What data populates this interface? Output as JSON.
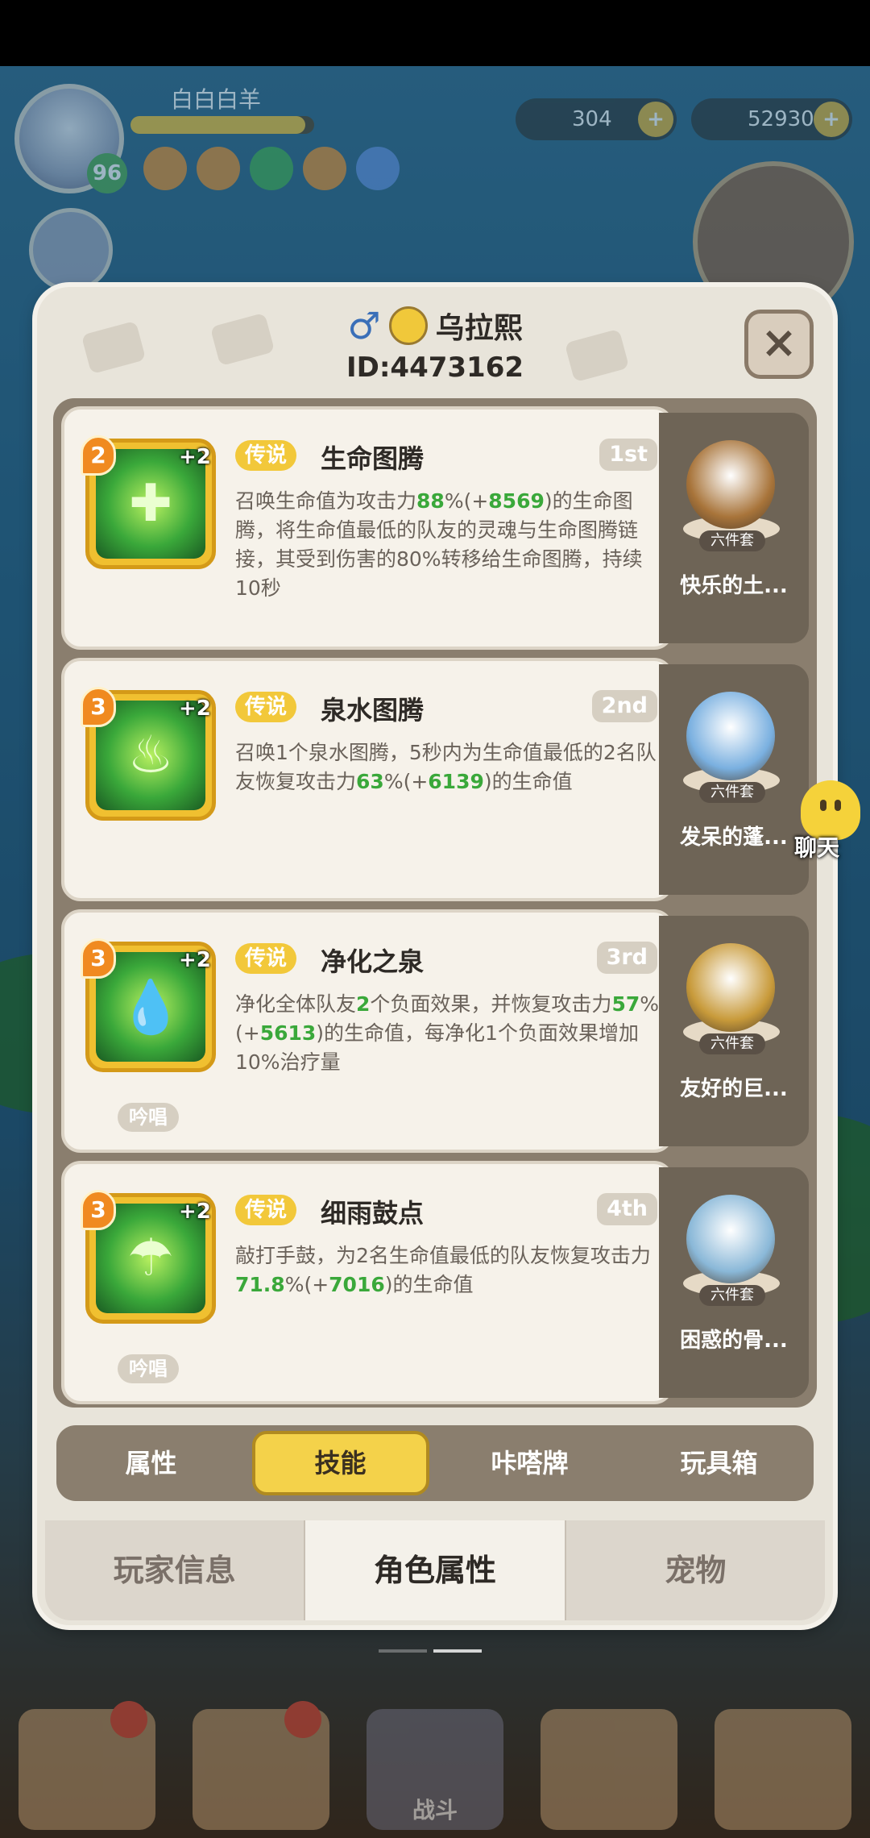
{
  "hud": {
    "player_name": "白白白羊",
    "level": "96",
    "exp_fraction": 0.95,
    "currency_shells": "304",
    "currency_pearls": "529303",
    "plus_symbol": "+"
  },
  "modal": {
    "gender_symbol": "♂",
    "player_name": "乌拉熙",
    "player_id": "ID:4473162",
    "close_symbol": "×"
  },
  "skills": [
    {
      "level": "2",
      "plus": "+2",
      "tag": "传说",
      "name": "生命图腾",
      "rank": "1st",
      "desc_parts": [
        [
          "召唤生命值为攻击力",
          ""
        ],
        [
          "88",
          "hl"
        ],
        [
          "%(+",
          ""
        ],
        [
          "8569",
          "hl"
        ],
        [
          ")的生命图腾，将生命值最低的队友的灵魂与生命图腾链接，其受到伤害的80%转移给生命图腾，持续10秒",
          ""
        ]
      ],
      "badge": "",
      "icon_glyph": "✚",
      "set_name": "快乐的土...",
      "set_tag": "六件套",
      "set_color": "#a8743a"
    },
    {
      "level": "3",
      "plus": "+2",
      "tag": "传说",
      "name": "泉水图腾",
      "rank": "2nd",
      "desc_parts": [
        [
          "召唤1个泉水图腾，5秒内为生命值最低的2名队友恢复攻击力",
          ""
        ],
        [
          "63",
          "hl"
        ],
        [
          "%(+",
          ""
        ],
        [
          "6139",
          "hl"
        ],
        [
          ")的生命值",
          ""
        ]
      ],
      "badge": "",
      "icon_glyph": "♨",
      "set_name": "发呆的蓬...",
      "set_tag": "六件套",
      "set_color": "#7ab0e0"
    },
    {
      "level": "3",
      "plus": "+2",
      "tag": "传说",
      "name": "净化之泉",
      "rank": "3rd",
      "desc_parts": [
        [
          "净化全体队友",
          ""
        ],
        [
          "2",
          "hl"
        ],
        [
          "个负面效果，并恢复攻击力",
          ""
        ],
        [
          "57",
          "hl"
        ],
        [
          "%(+",
          ""
        ],
        [
          "5613",
          "hl"
        ],
        [
          ")的生命值，每净化1个负面效果增加10%治疗量",
          ""
        ]
      ],
      "badge": "吟唱",
      "icon_glyph": "💧",
      "set_name": "友好的巨...",
      "set_tag": "六件套",
      "set_color": "#c89a3a"
    },
    {
      "level": "3",
      "plus": "+2",
      "tag": "传说",
      "name": "细雨鼓点",
      "rank": "4th",
      "desc_parts": [
        [
          "敲打手鼓，为2名生命值最低的队友恢复攻击力",
          ""
        ],
        [
          "71.8",
          "hl"
        ],
        [
          "%(+",
          ""
        ],
        [
          "7016",
          "hl"
        ],
        [
          ")的生命值",
          ""
        ]
      ],
      "badge": "吟唱",
      "icon_glyph": "☂",
      "set_name": "困惑的骨...",
      "set_tag": "六件套",
      "set_color": "#8ab8d8"
    }
  ],
  "sub_tabs": [
    "属性",
    "技能",
    "咔嗒牌",
    "玩具箱"
  ],
  "sub_tab_active": 1,
  "main_tabs": [
    "玩家信息",
    "角色属性",
    "宠物"
  ],
  "main_tab_active": 1,
  "chat_label": "聊天",
  "bottom_nav": {
    "center_label": "战斗"
  }
}
